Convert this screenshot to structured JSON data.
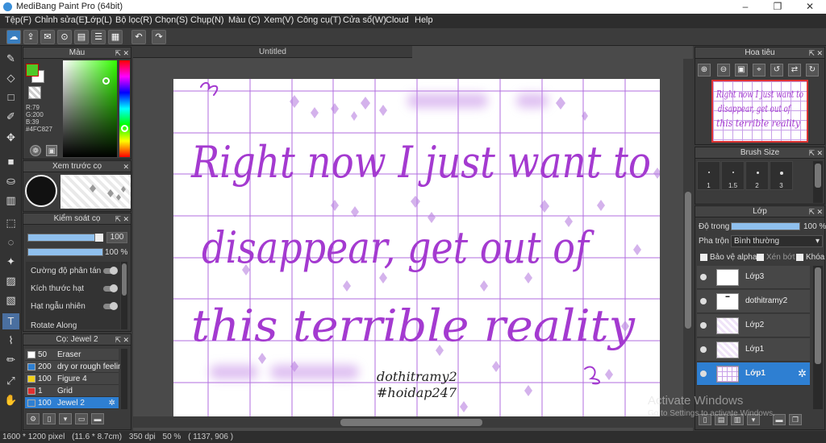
{
  "window": {
    "title": "MediBang Paint Pro (64bit)",
    "min": "–",
    "max": "❐",
    "close": "✕"
  },
  "menu": [
    "Tệp(F)",
    "Chỉnh sửa(E)",
    "Lớp(L)",
    "Bộ lọc(R)",
    "Chọn(S)",
    "Chụp(N)",
    "Màu (C)",
    "Xem(V)",
    "Công cụ(T)",
    "Cửa sổ(W)",
    "Cloud",
    "Help"
  ],
  "toolbar": {
    "undo": "↶",
    "redo": "↷"
  },
  "color_panel": {
    "title": "Màu",
    "r": "R:79",
    "g": "G:200",
    "b": "B:39",
    "hex": "#4FC827",
    "primary": "#4FC827",
    "secondary": "#ffffff"
  },
  "preview_panel": {
    "title": "Xem trước cọ",
    "brush_label": "Jewel 2"
  },
  "brush_control": {
    "title": "Kiểm soát cọ",
    "size_value": "100",
    "opacity_value": "100 %",
    "rows": [
      "Cường độ phân tán",
      "Kích thước hạt",
      "Hạt ngẫu nhiên",
      "Rotate Along"
    ]
  },
  "brush_panel": {
    "title": "Cọ: Jewel 2",
    "items": [
      {
        "size": "50",
        "name": "Eraser",
        "color": "#ffffff"
      },
      {
        "size": "200",
        "name": "dry or rough feeling",
        "color": "#2e7fd2"
      },
      {
        "size": "100",
        "name": "Figure 4",
        "color": "#f2d016"
      },
      {
        "size": "1",
        "name": "Grid",
        "color": "#e03030"
      },
      {
        "size": "100",
        "name": "Jewel 2",
        "color": "#2e7fd2"
      }
    ]
  },
  "document": {
    "tab": "Untitled",
    "lines": [
      "Right now I just want to",
      "disappear, get out of",
      "this terrible reality"
    ],
    "signature_1": "dothitramy2",
    "signature_2": "#hoidap247",
    "ink_color": "#a43ad0",
    "grid_color": "#a04ad8"
  },
  "navigator": {
    "title": "Hoa tiêu"
  },
  "brush_size": {
    "title": "Brush Size",
    "sizes": [
      "1",
      "1.5",
      "2",
      "3"
    ]
  },
  "layer_panel": {
    "title": "Lớp",
    "opacity_label": "Độ trong",
    "opacity_value": "100 %",
    "opacity": 1.0,
    "blend_label": "Pha trộn",
    "blend_value": "Bình thường",
    "protect_alpha": "Bảo vệ alpha",
    "clipping": "Xén bớt",
    "lock": "Khóa",
    "layers": [
      "Lớp3",
      "dothitramy2",
      "Lớp2",
      "Lớp1",
      "Lớp1"
    ]
  },
  "status": {
    "size": "1600 * 1200 pixel",
    "cm": "(11.6 * 8.7cm)",
    "dpi": "350 dpi",
    "zoom": "50 %",
    "coords": "( 1137, 906 )"
  },
  "watermark": {
    "line1": "Activate Windows",
    "line2": "Go to Settings to activate Windows."
  }
}
